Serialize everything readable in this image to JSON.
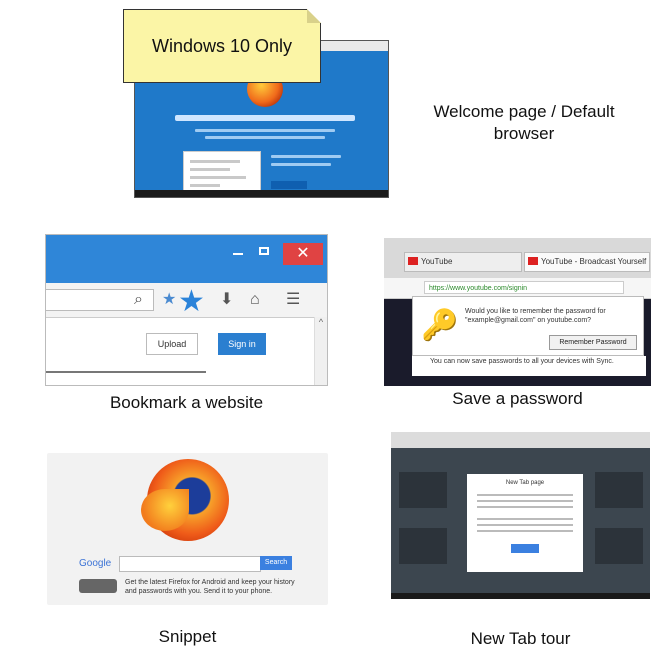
{
  "tiles": {
    "welcome": {
      "caption_line1": "Welcome page / Default",
      "caption_line2": "browser",
      "note": "Windows 10 Only"
    },
    "bookmark": {
      "caption": "Bookmark a website",
      "close_glyph": "✕",
      "upload_label": "Upload",
      "signin_label": "Sign in"
    },
    "password": {
      "caption": "Save a password",
      "tab1": "YouTube",
      "tab2": "YouTube - Broadcast Yourself",
      "url": "https://www.youtube.com/signin",
      "message": "Would you like to remember the password for \"example@gmail.com\" on youtube.com?",
      "remember_button": "Remember Password",
      "info": "You can now save passwords to all your devices with Sync."
    },
    "snippet": {
      "caption": "Snippet",
      "google_label": "Google",
      "search_button": "Search",
      "snippet_text": "Get the latest Firefox for Android and keep your history and passwords with you. Send it to your phone."
    },
    "newtab": {
      "caption": "New Tab tour",
      "dialog_title": "New Tab page"
    }
  },
  "colors": {
    "note_bg": "#fbf5a6",
    "win10_blue": "#1f79c9",
    "accent_blue": "#2b83d9",
    "close_red": "#e04343",
    "firefox_orange": "#ef5b19"
  },
  "icons": [
    "firefox-logo-icon",
    "star-icon",
    "key-icon",
    "search-icon",
    "home-icon",
    "download-icon",
    "menu-icon",
    "close-icon"
  ]
}
